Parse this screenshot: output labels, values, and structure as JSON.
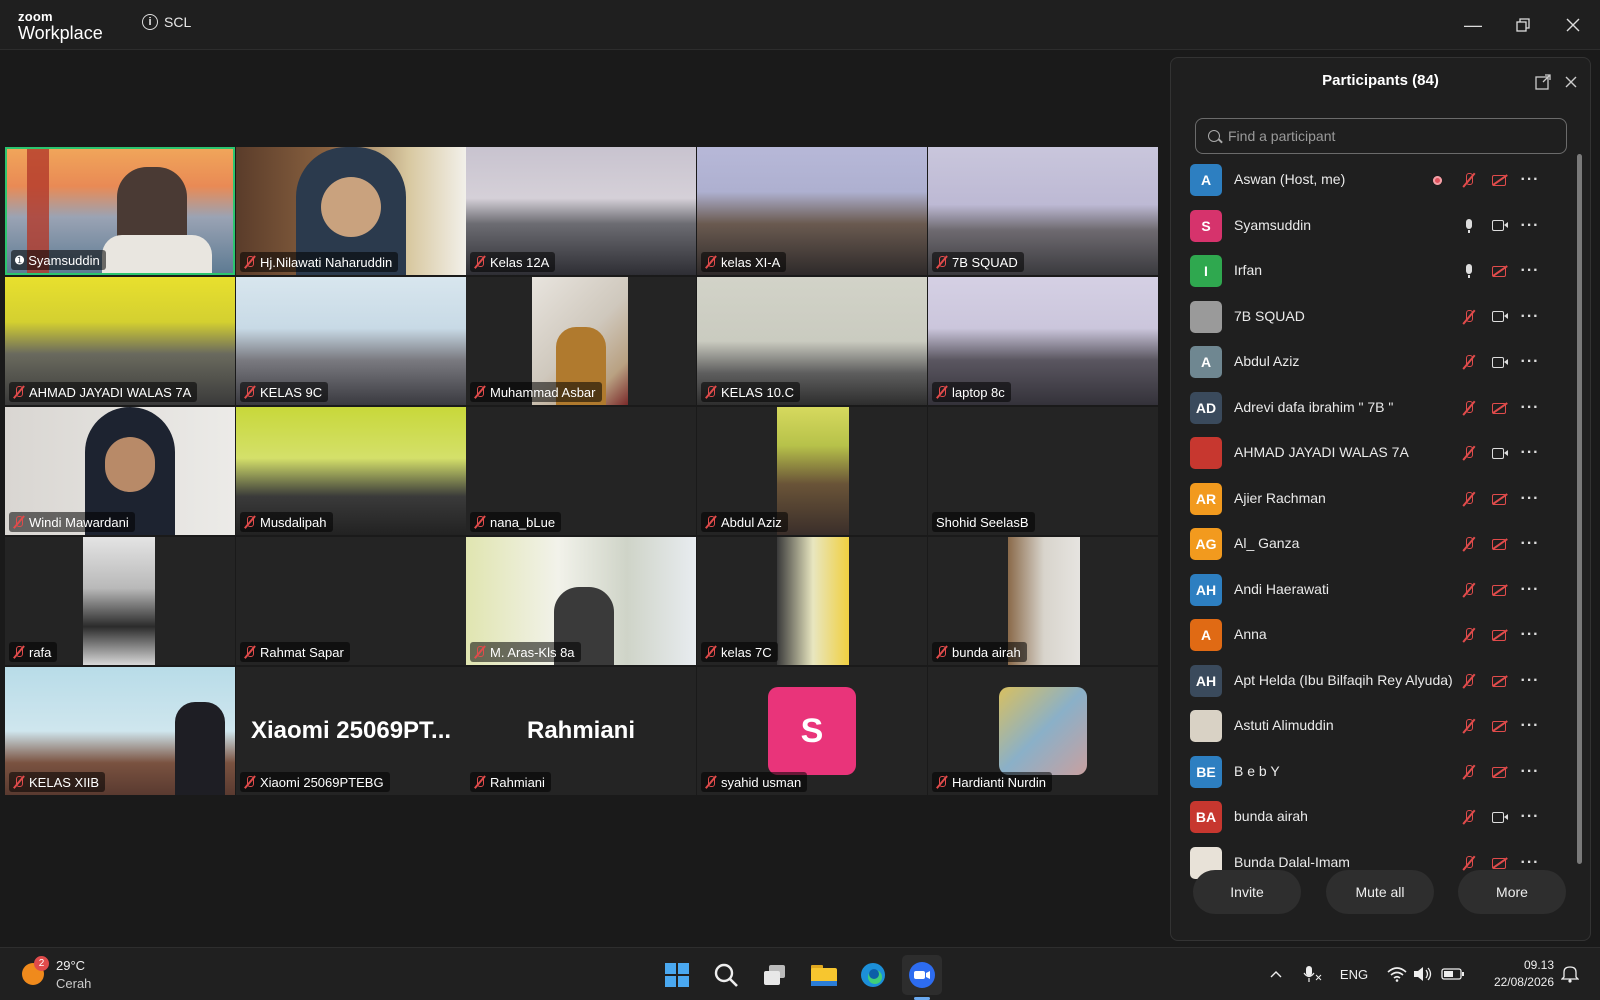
{
  "app": {
    "brand_top": "zoom",
    "brand_bottom": "Workplace",
    "meeting_label": "SCL"
  },
  "colors": {
    "active_border": "#2cc56f",
    "mic_off": "#e04b4b",
    "panel_bg": "#1f1f1f"
  },
  "tiles": [
    "Syamsuddin",
    "Hj.Nilawati Naharuddin",
    "Kelas 12A",
    "kelas XI-A",
    "7B SQUAD",
    "AHMAD JAYADI WALAS 7A",
    "KELAS 9C",
    "Muhammad Asbar",
    "KELAS 10.C",
    "laptop 8c",
    "Windi Mawardani",
    "Musdalipah",
    "nana_bLue",
    "Abdul Aziz",
    "Shohid SeelasB",
    "rafa",
    "Rahmat Sapar",
    "M. Aras-Kls 8a",
    "kelas 7C",
    "bunda airah",
    "KELAS XIIB",
    "Xiaomi 25069PTEBG",
    "Rahmiani",
    "syahid usman",
    "Hardianti Nurdin"
  ],
  "tile_big_text": {
    "xiaomi": "Xiaomi  25069PT...",
    "rahmiani": "Rahmiani",
    "syahid_initial": "S"
  },
  "participants": {
    "title": "Participants (84)",
    "search_placeholder": "Find a participant",
    "list": [
      {
        "initials": "A",
        "name": "Aswan (Host, me)",
        "color": "#2d7fc1"
      },
      {
        "initials": "S",
        "name": "Syamsuddin",
        "color": "#d6336c"
      },
      {
        "initials": "I",
        "name": "Irfan",
        "color": "#2fa84f"
      },
      {
        "initials": "",
        "name": "7B SQUAD",
        "color": "#9a9a9a"
      },
      {
        "initials": "A",
        "name": "Abdul Aziz",
        "color": "#6f8791"
      },
      {
        "initials": "AD",
        "name": "Adrevi dafa ibrahim \" 7B \"",
        "color": "#3a4a5c"
      },
      {
        "initials": "",
        "name": "AHMAD JAYADI WALAS 7A",
        "color": "#c7372f"
      },
      {
        "initials": "AR",
        "name": "Ajier Rachman",
        "color": "#f29a1e"
      },
      {
        "initials": "AG",
        "name": "Al_ Ganza",
        "color": "#f29a1e"
      },
      {
        "initials": "AH",
        "name": "Andi Haerawati",
        "color": "#2d7fc1"
      },
      {
        "initials": "A",
        "name": "Anna",
        "color": "#e06a14"
      },
      {
        "initials": "AH",
        "name": "Apt Helda (Ibu Bilfaqih Rey Alyuda)",
        "color": "#3a4a5c"
      },
      {
        "initials": "",
        "name": "Astuti Alimuddin",
        "color": "#d9d2c5"
      },
      {
        "initials": "BE",
        "name": "B e b Y",
        "color": "#2d7fc1"
      },
      {
        "initials": "BA",
        "name": "bunda airah",
        "color": "#c7372f"
      },
      {
        "initials": "",
        "name": "Bunda Dalal-Imam",
        "color": "#e8e2d8"
      }
    ],
    "buttons": {
      "invite": "Invite",
      "mute_all": "Mute all",
      "more": "More"
    }
  },
  "taskbar": {
    "badge": "2",
    "temp": "29°C",
    "condition": "Cerah",
    "lang": "ENG",
    "time": "09.13",
    "date": "22/08/2026"
  }
}
